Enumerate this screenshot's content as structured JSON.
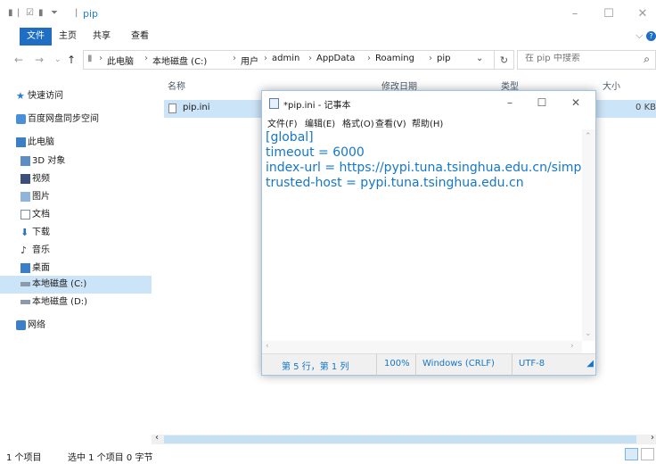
{
  "window": {
    "title": "pip"
  },
  "ribbon": {
    "tabs": [
      "文件",
      "主页",
      "共享",
      "查看"
    ]
  },
  "address": {
    "breadcrumbs": [
      "此电脑",
      "本地磁盘 (C:)",
      "用户",
      "admin",
      "AppData",
      "Roaming",
      "pip"
    ],
    "search_placeholder": "在 pip 中搜索"
  },
  "nav": {
    "quick_access": "快速访问",
    "baidu": "百度网盘同步空间",
    "this_pc": "此电脑",
    "items": [
      "3D 对象",
      "视频",
      "图片",
      "文档",
      "下载",
      "音乐",
      "桌面"
    ],
    "drive_c": "本地磁盘 (C:)",
    "drive_d": "本地磁盘 (D:)",
    "network": "网络"
  },
  "columns": {
    "name": "名称",
    "modified": "修改日期",
    "type": "类型",
    "size": "大小"
  },
  "files": [
    {
      "name": "pip.ini",
      "size": "0 KB"
    }
  ],
  "status": {
    "count": "1 个项目",
    "selected": "选中 1 个项目 0 字节"
  },
  "notepad": {
    "title": "*pip.ini - 记事本",
    "menu": [
      "文件(F)",
      "编辑(E)",
      "格式(O)",
      "查看(V)",
      "帮助(H)"
    ],
    "lines": [
      "[global]",
      "timeout = 6000",
      "index-url = https://pypi.tuna.tsinghua.edu.cn/simple",
      "trusted-host = pypi.tuna.tsinghua.edu.cn"
    ],
    "status_position": "第 5 行，第 1 列",
    "status_zoom": "100%",
    "status_eol": "Windows (CRLF)",
    "status_encoding": "UTF-8"
  },
  "colors": {
    "accent": "#1f6ec3",
    "selection": "#cce4f7",
    "text_blue": "#1577c8"
  }
}
